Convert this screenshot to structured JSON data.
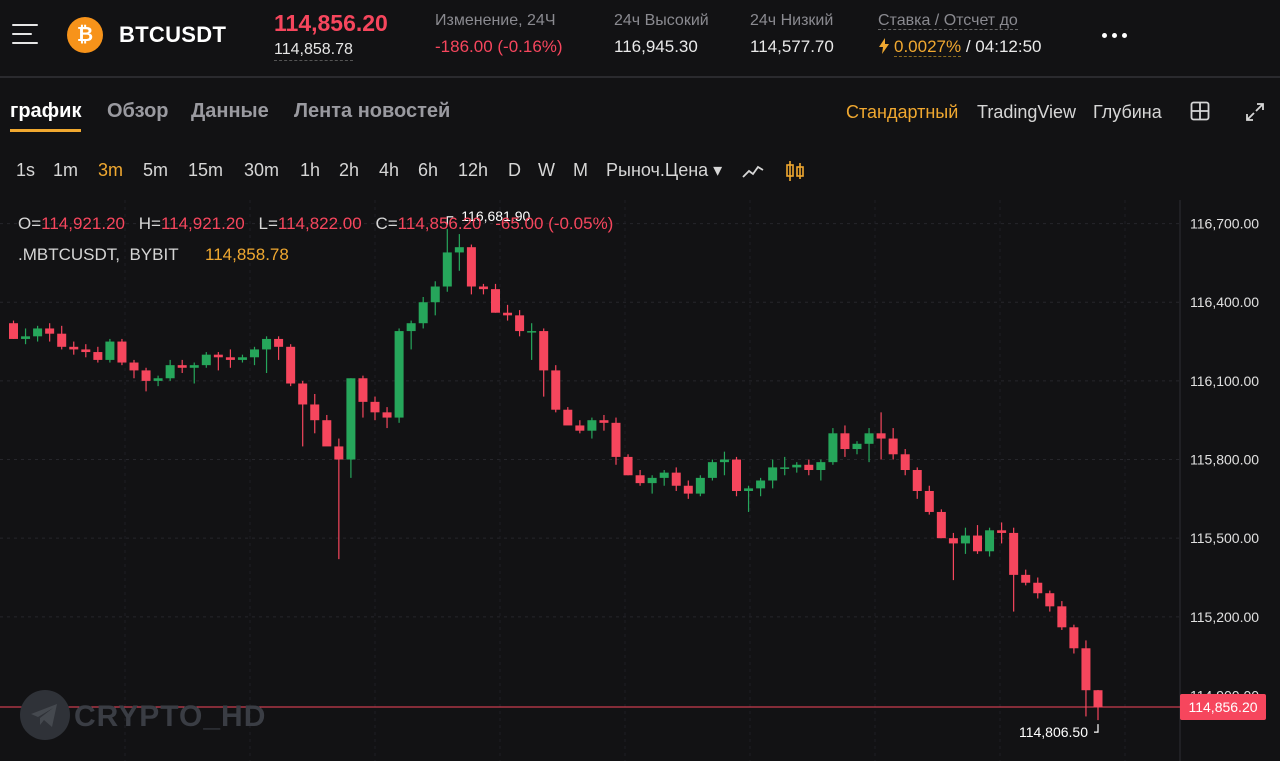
{
  "header": {
    "menu_icon": "hamburger-menu-icon",
    "coin_symbol_glyph": "₿",
    "symbol": "BTCUSDT",
    "last_price": "114,856.20",
    "mark_price": "114,858.78",
    "change_label": "Изменение, 24Ч",
    "change_value": "-186.00 (-0.16%)",
    "high_label": "24ч Высокий",
    "high_value": "116,945.30",
    "low_label": "24ч Низкий",
    "low_value": "114,577.70",
    "funding_label": "Ставка / Отсчет до",
    "funding_rate": "0.0027%",
    "funding_countdown": "/ 04:12:50",
    "more_icon": "more-dots-icon"
  },
  "tabs": [
    {
      "label": "график",
      "active": true
    },
    {
      "label": "Обзор",
      "active": false
    },
    {
      "label": "Данные",
      "active": false
    },
    {
      "label": "Лента новостей",
      "active": false
    }
  ],
  "view_options": [
    {
      "label": "Стандартный",
      "active": true
    },
    {
      "label": "TradingView",
      "active": false
    },
    {
      "label": "Глубина",
      "active": false
    }
  ],
  "intervals": [
    {
      "label": "1s",
      "active": false
    },
    {
      "label": "1m",
      "active": false
    },
    {
      "label": "3m",
      "active": true
    },
    {
      "label": "5m",
      "active": false
    },
    {
      "label": "15m",
      "active": false
    },
    {
      "label": "30m",
      "active": false
    },
    {
      "label": "1h",
      "active": false
    },
    {
      "label": "2h",
      "active": false
    },
    {
      "label": "4h",
      "active": false
    },
    {
      "label": "6h",
      "active": false
    },
    {
      "label": "12h",
      "active": false
    },
    {
      "label": "D",
      "active": false
    },
    {
      "label": "W",
      "active": false
    },
    {
      "label": "M",
      "active": false
    }
  ],
  "price_type": "Рыноч.Цена ▾",
  "ohlc": {
    "o_key": "O=",
    "o": "114,921.20",
    "h_key": "H=",
    "h": "114,921.20",
    "l_key": "L=",
    "l": "114,822.00",
    "c_key": "C=",
    "c": "114,856.20",
    "change": "-65.00 (-0.05%)"
  },
  "instrument": {
    "name": ".MBTCUSDT,",
    "exchange": "BYBIT",
    "mark_price": "114,858.78"
  },
  "watermark": "CRYPTO_HD",
  "colors": {
    "up": "#26a65b",
    "down": "#f6465d",
    "accent": "#f0a830",
    "background": "#121214"
  },
  "chart_data": {
    "type": "candlestick",
    "y_ticks": [
      "116,700.00",
      "116,400.00",
      "116,100.00",
      "115,800.00",
      "115,500.00",
      "115,200.00"
    ],
    "y_tick_values": [
      116700,
      116400,
      116100,
      115800,
      115500,
      115200
    ],
    "ylim": [
      114650,
      116790
    ],
    "current_price_label": "114,856.20",
    "current_price": 114856.2,
    "partial_tick_label": "114,900.00",
    "high_marker": {
      "label": "116,681.90",
      "candle": 36
    },
    "low_marker": {
      "label": "114,806.50",
      "candle": 90
    },
    "candles": [
      [
        116320,
        116330,
        116260,
        116260
      ],
      [
        116260,
        116300,
        116240,
        116270
      ],
      [
        116270,
        116310,
        116250,
        116300
      ],
      [
        116300,
        116320,
        116250,
        116280
      ],
      [
        116280,
        116310,
        116220,
        116230
      ],
      [
        116230,
        116250,
        116200,
        116220
      ],
      [
        116220,
        116240,
        116190,
        116210
      ],
      [
        116210,
        116230,
        116170,
        116180
      ],
      [
        116180,
        116260,
        116170,
        116250
      ],
      [
        116250,
        116260,
        116160,
        116170
      ],
      [
        116170,
        116180,
        116110,
        116140
      ],
      [
        116140,
        116150,
        116060,
        116100
      ],
      [
        116100,
        116120,
        116080,
        116110
      ],
      [
        116110,
        116180,
        116100,
        116160
      ],
      [
        116160,
        116180,
        116130,
        116150
      ],
      [
        116150,
        116170,
        116090,
        116160
      ],
      [
        116160,
        116210,
        116150,
        116200
      ],
      [
        116200,
        116210,
        116140,
        116190
      ],
      [
        116190,
        116220,
        116150,
        116180
      ],
      [
        116180,
        116200,
        116170,
        116190
      ],
      [
        116190,
        116230,
        116160,
        116220
      ],
      [
        116220,
        116270,
        116130,
        116260
      ],
      [
        116260,
        116270,
        116180,
        116230
      ],
      [
        116230,
        116240,
        116080,
        116090
      ],
      [
        116090,
        116100,
        115850,
        116010
      ],
      [
        116010,
        116050,
        115900,
        115950
      ],
      [
        115950,
        115970,
        115890,
        115850
      ],
      [
        115850,
        115880,
        115420,
        115800
      ],
      [
        115800,
        116110,
        115730,
        116110
      ],
      [
        116110,
        116120,
        115960,
        116020
      ],
      [
        116020,
        116040,
        115950,
        115980
      ],
      [
        115980,
        116000,
        115920,
        115960
      ],
      [
        115960,
        116300,
        115940,
        116290
      ],
      [
        116290,
        116330,
        116220,
        116320
      ],
      [
        116320,
        116420,
        116300,
        116400
      ],
      [
        116400,
        116480,
        116350,
        116460
      ],
      [
        116460,
        116680,
        116440,
        116590
      ],
      [
        116590,
        116660,
        116520,
        116610
      ],
      [
        116610,
        116620,
        116430,
        116460
      ],
      [
        116460,
        116470,
        116430,
        116450
      ],
      [
        116450,
        116470,
        116360,
        116360
      ],
      [
        116360,
        116390,
        116330,
        116350
      ],
      [
        116350,
        116370,
        116270,
        116290
      ],
      [
        116290,
        116320,
        116180,
        116290
      ],
      [
        116290,
        116300,
        116040,
        116140
      ],
      [
        116140,
        116160,
        115980,
        115990
      ],
      [
        115990,
        116000,
        115940,
        115930
      ],
      [
        115930,
        115950,
        115900,
        115910
      ],
      [
        115910,
        115960,
        115880,
        115950
      ],
      [
        115950,
        115970,
        115910,
        115940
      ],
      [
        115940,
        115960,
        115780,
        115810
      ],
      [
        115810,
        115820,
        115740,
        115740
      ],
      [
        115740,
        115760,
        115700,
        115710
      ],
      [
        115710,
        115740,
        115670,
        115730
      ],
      [
        115730,
        115760,
        115700,
        115750
      ],
      [
        115750,
        115770,
        115680,
        115700
      ],
      [
        115700,
        115720,
        115650,
        115670
      ],
      [
        115670,
        115740,
        115660,
        115730
      ],
      [
        115730,
        115800,
        115720,
        115790
      ],
      [
        115790,
        115830,
        115740,
        115800
      ],
      [
        115800,
        115810,
        115660,
        115680
      ],
      [
        115680,
        115700,
        115600,
        115690
      ],
      [
        115690,
        115730,
        115660,
        115720
      ],
      [
        115720,
        115800,
        115690,
        115770
      ],
      [
        115770,
        115810,
        115740,
        115770
      ],
      [
        115770,
        115790,
        115750,
        115780
      ],
      [
        115780,
        115800,
        115740,
        115760
      ],
      [
        115760,
        115800,
        115720,
        115790
      ],
      [
        115790,
        115920,
        115780,
        115900
      ],
      [
        115900,
        115930,
        115810,
        115840
      ],
      [
        115840,
        115870,
        115820,
        115860
      ],
      [
        115860,
        115920,
        115790,
        115900
      ],
      [
        115900,
        115980,
        115800,
        115880
      ],
      [
        115880,
        115920,
        115800,
        115820
      ],
      [
        115820,
        115840,
        115740,
        115760
      ],
      [
        115760,
        115770,
        115650,
        115680
      ],
      [
        115680,
        115700,
        115590,
        115600
      ],
      [
        115600,
        115610,
        115500,
        115500
      ],
      [
        115500,
        115520,
        115340,
        115480
      ],
      [
        115480,
        115540,
        115440,
        115510
      ],
      [
        115510,
        115550,
        115440,
        115450
      ],
      [
        115450,
        115540,
        115430,
        115530
      ],
      [
        115530,
        115560,
        115480,
        115520
      ],
      [
        115520,
        115540,
        115220,
        115360
      ],
      [
        115360,
        115380,
        115320,
        115330
      ],
      [
        115330,
        115350,
        115270,
        115290
      ],
      [
        115290,
        115300,
        115220,
        115240
      ],
      [
        115240,
        115260,
        115150,
        115160
      ],
      [
        115160,
        115170,
        115060,
        115080
      ],
      [
        115080,
        115110,
        114820,
        114920
      ],
      [
        114920,
        114921,
        114806,
        114856
      ]
    ]
  }
}
